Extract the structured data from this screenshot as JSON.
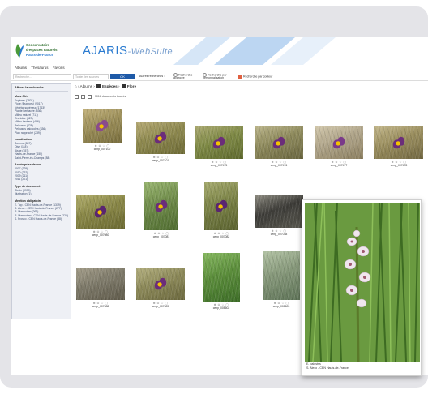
{
  "app": {
    "logo_lines": [
      "Conservatoire",
      "d'espaces naturels",
      "Hauts-de-France"
    ],
    "brand": "AJARIS",
    "brand_sub": "-WebSuite"
  },
  "menubar": {
    "items": [
      "Albums",
      "Thésaurus",
      "Favoris"
    ]
  },
  "searchbar": {
    "search_placeholder": "Recherche...",
    "scope_placeholder": "Toutes les sources",
    "ok_label": "OK",
    "other_search_label": "Autres recherches :",
    "advanced_search_label": "Recherche avancée",
    "custom_search_label": "Recherche par personnalisation",
    "color_search_label": "Recherche par couleur"
  },
  "sidebar": {
    "header": "Affiner la recherche",
    "sections": [
      {
        "title": "Mots Clés",
        "items": [
          "Espèces (2931)",
          "Flore (Espèces) (2017)",
          "Végétal supérieur (1763)",
          "Plante herbacée (536)",
          "Milieu naturel (711)",
          "Orchidée (523)",
          "Milieu herbacé (436)",
          "Pelouses (428)",
          "Pelouses calcicoles (336)",
          "Plan rapproché (239)"
        ]
      },
      {
        "title": "Localisation",
        "items": [
          "Somme (807)",
          "Oise (118)",
          "Aisne (357)",
          "Hauts-de-France (155)",
          "Saint-Pierre-ès-Champs (88)"
        ]
      },
      {
        "title": "Année prise de vue",
        "items": [
          "2007 (329)",
          "2010 (232)",
          "2009 (211)",
          "2011 (201)"
        ]
      },
      {
        "title": "Type de document",
        "items": [
          "Photo (3016)",
          "Illustration (1)"
        ]
      },
      {
        "title": "Mention obligatoire",
        "items": [
          "E. Top - CEN Hauts-de-France (1319)",
          "S. Alexo - CEN Hauts-de-France (277)",
          "R. Marmottan (262)",
          "R. Marmottan - CEN Hauts-de-France (220)",
          "S. Frosco - CEN Hauts-de-France (88)"
        ]
      }
    ]
  },
  "breadcrumb": [
    "Albums",
    "Espèces",
    "Flore"
  ],
  "results_count": "3016 documents trouvés",
  "thumbnails": [
    {
      "name": "cenp_007100"
    },
    {
      "name": "cenp_007101"
    },
    {
      "name": "cenp_007475"
    },
    {
      "name": "cenp_007476"
    },
    {
      "name": "cenp_007477"
    },
    {
      "name": "cenp_007478"
    },
    {
      "name": "cenp_007080"
    },
    {
      "name": "cenp_007081"
    },
    {
      "name": "cenp_007082"
    },
    {
      "name": "cenp_007038"
    },
    {
      "name": "cenp_007088"
    },
    {
      "name": "cenp_007089"
    },
    {
      "name": "cenp_008602"
    },
    {
      "name": "cenp_008603"
    }
  ],
  "thumb_icons": "⊕ ⊙ ☆ ▢",
  "preview": {
    "caption_lines": [
      "E. palustris",
      "S. Alexo - CEN Hauts-de-France"
    ]
  }
}
